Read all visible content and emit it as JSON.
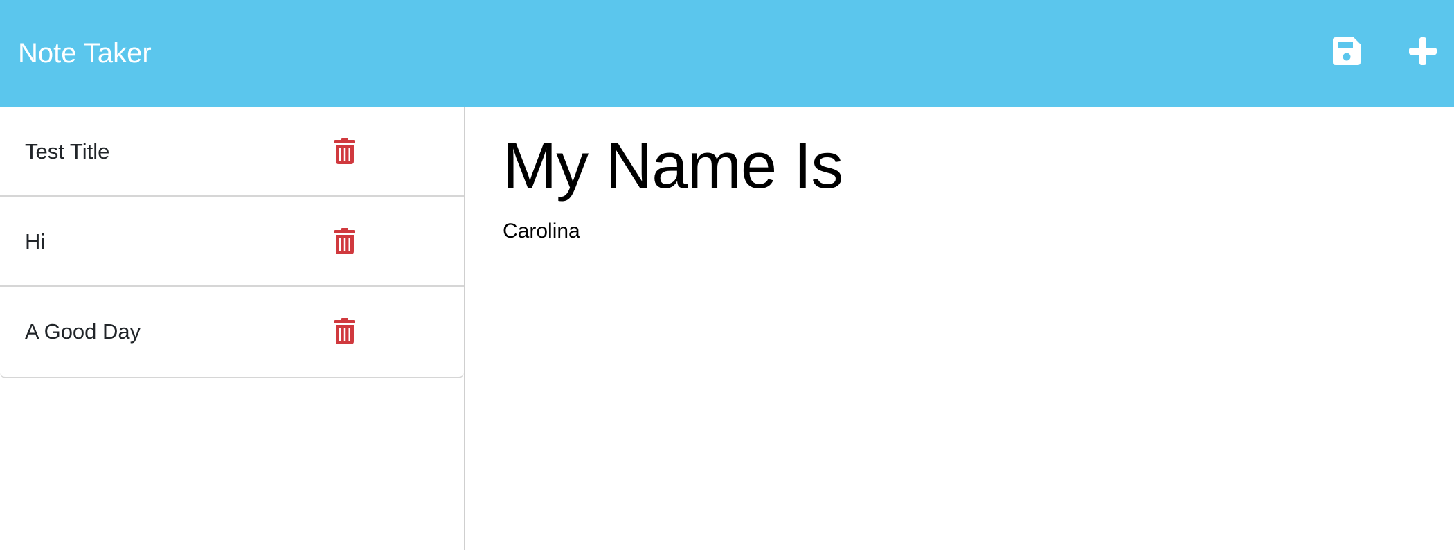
{
  "navbar": {
    "brand": "Note Taker",
    "background_color": "#5bc6ed",
    "save_icon": "floppy-disk-icon",
    "new_icon": "plus-icon"
  },
  "sidebar": {
    "delete_icon": "trash-icon",
    "delete_color": "#d0393e",
    "notes": [
      {
        "title": "Test Title"
      },
      {
        "title": "Hi"
      },
      {
        "title": "A Good Day"
      }
    ]
  },
  "main": {
    "note_title": "My Name Is",
    "note_text": "Carolina"
  }
}
